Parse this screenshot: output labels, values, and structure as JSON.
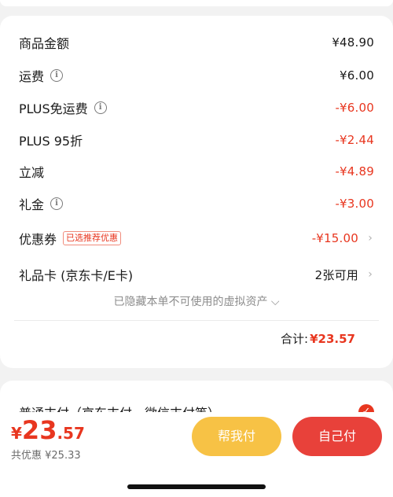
{
  "summary": {
    "rows": [
      {
        "label": "商品金额",
        "amount": "¥48.90"
      },
      {
        "label": "运费",
        "amount": "¥6.00"
      },
      {
        "label": "PLUS免运费",
        "amount": "-¥6.00"
      },
      {
        "label": "PLUS 95折",
        "amount": "-¥2.44"
      },
      {
        "label": "立减",
        "amount": "-¥4.89"
      },
      {
        "label": "礼金",
        "amount": "-¥3.00"
      },
      {
        "label": "优惠券",
        "badge": "已选推荐优惠",
        "amount": "-¥15.00"
      },
      {
        "label": "礼品卡 (京东卡/E卡)",
        "amount": "2张可用"
      }
    ],
    "hidden_note": "已隐藏本单不可使用的虚拟资产",
    "total_label": "合计:",
    "total_value": "¥23.57"
  },
  "payment": {
    "method_label": "普通支付（京东支付、微信支付等）"
  },
  "bottom_bar": {
    "currency": "¥",
    "price_int": "23",
    "price_dec": ".57",
    "saving": "共优惠 ¥25.33",
    "help_pay_label": "帮我付",
    "self_pay_label": "自己付"
  },
  "icons": {
    "info": "info-icon",
    "chevron": "chevron-right-icon",
    "check": "check-icon",
    "expand": "chevron-down-icon"
  },
  "colors": {
    "accent_red": "#e8361f",
    "help_button": "#f7c245",
    "self_button": "#e8413a"
  }
}
